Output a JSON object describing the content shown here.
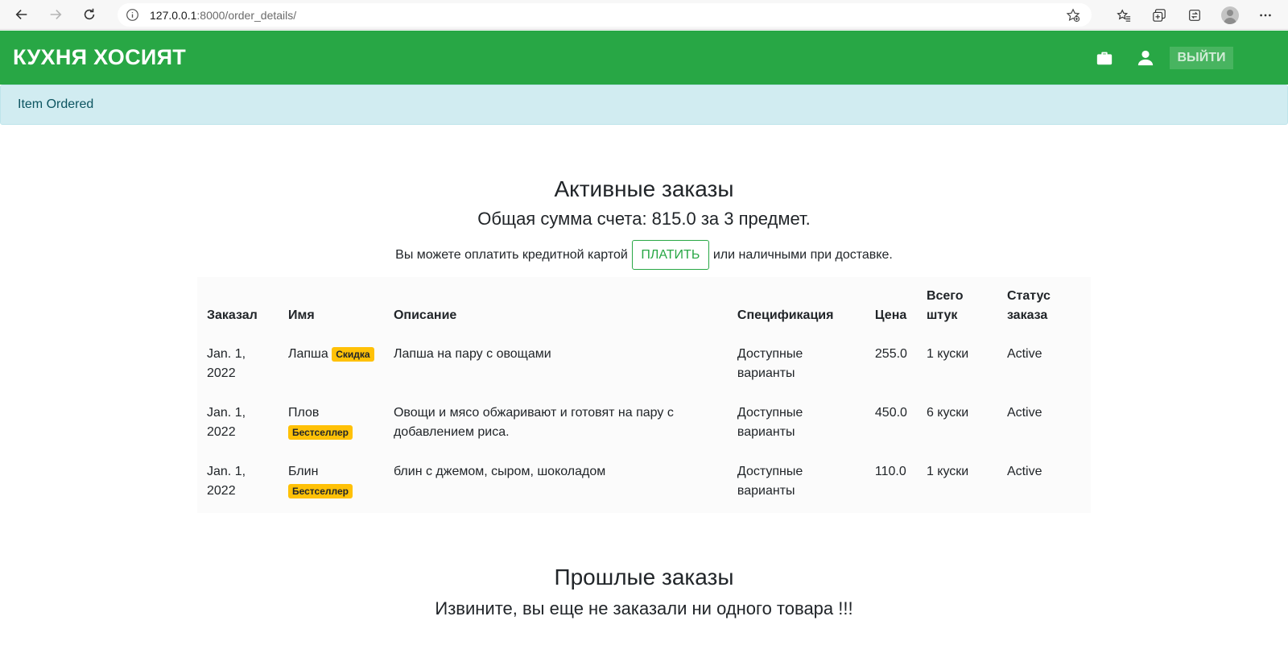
{
  "browser": {
    "url_host": "127.0.0.1",
    "url_rest": ":8000/order_details/"
  },
  "navbar": {
    "brand": "КУХНЯ ХОСИЯТ",
    "logout_label": "ВЫЙТИ"
  },
  "alert": {
    "message": "Item Ordered"
  },
  "active_orders": {
    "title": "Активные заказы",
    "total_text": "Общая сумма счета: 815.0 за 3 предмет.",
    "pay_prefix": "Вы можете оплатить кредитной картой",
    "pay_button": "ПЛАТИТЬ",
    "pay_suffix": "или наличными при доставке.",
    "columns": [
      "Заказал",
      "Имя",
      "Описание",
      "Спецификация",
      "Цена",
      "Всего штук",
      "Статус заказа"
    ],
    "rows": [
      {
        "date": "Jan. 1, 2022",
        "name": "Лапша",
        "badge": "Скидка",
        "description": "Лапша на пару с овощами",
        "spec": "Доступные варианты",
        "price": "255.0",
        "qty": "1 куски",
        "status": "Active"
      },
      {
        "date": "Jan. 1, 2022",
        "name": "Плов",
        "badge": "Бестселлер",
        "description": "Овощи и мясо обжаривают и готовят на пару с добавлением риса.",
        "spec": "Доступные варианты",
        "price": "450.0",
        "qty": "6 куски",
        "status": "Active"
      },
      {
        "date": "Jan. 1, 2022",
        "name": "Блин",
        "badge": "Бестселлер",
        "description": "блин с джемом, сыром, шоколадом",
        "spec": "Доступные варианты",
        "price": "110.0",
        "qty": "1 куски",
        "status": "Active"
      }
    ]
  },
  "past_orders": {
    "title": "Прошлые заказы",
    "empty_text": "Извините, вы еще не заказали ни одного товара !!!"
  },
  "colors": {
    "navbar": "#28a745",
    "alert_bg": "#d1ecf1",
    "badge": "#ffc107"
  }
}
